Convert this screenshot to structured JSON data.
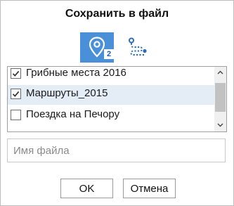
{
  "dialog": {
    "title": "Сохранить в файл"
  },
  "tabs": {
    "poi": {
      "icon": "map-pin-icon",
      "badge": "2",
      "active": true,
      "accent": "#4a90d9"
    },
    "routes": {
      "icon": "route-icon",
      "active": false,
      "accent": "#2a6fb5"
    }
  },
  "list": {
    "items": [
      {
        "label": "Грибные места 2016",
        "checked": true,
        "selected": false
      },
      {
        "label": "Маршруты_2015",
        "checked": true,
        "selected": true
      },
      {
        "label": "Поездка на Печору",
        "checked": false,
        "selected": false
      }
    ]
  },
  "filename": {
    "value": "",
    "placeholder": "Имя файла"
  },
  "buttons": {
    "ok": "OK",
    "cancel": "Отмена"
  }
}
